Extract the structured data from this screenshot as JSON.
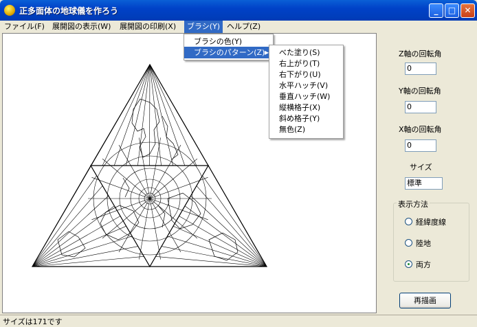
{
  "window": {
    "title": "正多面体の地球儀を作ろう",
    "minimize": "_",
    "maximize": "□",
    "close": "✕"
  },
  "menu": [
    "ファイル(F)",
    "展開図の表示(W)",
    "展開図の印刷(X)",
    "ブラシ(Y)",
    "ヘルプ(Z)"
  ],
  "brush_menu": {
    "items": [
      "ブラシの色(Y)",
      "ブラシのパターン(Z)"
    ],
    "submenu_arrow": "▶"
  },
  "pattern_menu": {
    "items": [
      "べた塗り(S)",
      "右上がり(T)",
      "右下がり(U)",
      "水平ハッチ(V)",
      "垂直ハッチ(W)",
      "縦横格子(X)",
      "斜め格子(Y)",
      "無色(Z)"
    ]
  },
  "controls": {
    "z_label": "Z軸の回転角",
    "z_value": "0",
    "y_label": "Y軸の回転角",
    "y_value": "0",
    "x_label": "X軸の回転角",
    "x_value": "0",
    "size_label": "サイズ",
    "size_value": "標準",
    "display_group": "表示方法",
    "display_options": [
      "経緯度線",
      "陸地",
      "両方"
    ],
    "selected_option": "両方",
    "redraw": "再描画"
  },
  "status": "サイズは171です"
}
